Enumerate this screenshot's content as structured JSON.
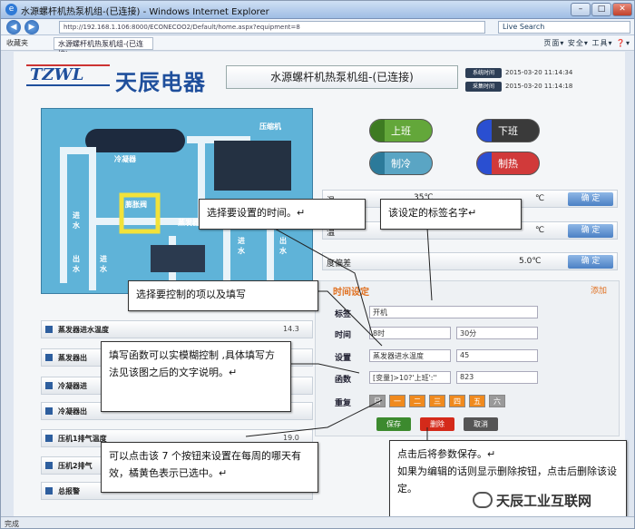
{
  "window": {
    "title": "水源螺杆机热泵机组-(已连接) - Windows Internet Explorer",
    "url": "http://192.168.1.106:8000/ECONECOO2/Default/home.aspx?equipment=8",
    "search": "Live Search",
    "favorites": "收藏夹",
    "tab": "水源螺杆机热泵机组-(已连接)",
    "tools": "页面▾ 安全▾ 工具▾ ❓▾",
    "status": "完成"
  },
  "header": {
    "logo": "TZWL",
    "brand": "天辰电器",
    "machine": "水源螺杆机热泵机组-(已连接)",
    "sys_time_label": "系统时间",
    "sys_time": "2015-03-20 11:14:34",
    "collect_time_label": "采集时间",
    "collect_time": "2015-03-20 11:14:18"
  },
  "diagram": {
    "compressor": "压缩机",
    "condenser": "冷凝器",
    "expansion": "膨胀阀",
    "evaporator": "蒸发器",
    "inlet1": "进水",
    "outlet1": "出水",
    "inlet2": "进水",
    "outlet2": "出水",
    "inlet3": "进水",
    "outlet3": "出水"
  },
  "buttons": {
    "on": "上班",
    "off": "下班",
    "cool": "制冷",
    "heat": "制热"
  },
  "settings": [
    {
      "label": "温",
      "value": "35℃",
      "val2": "℃",
      "ok": "确 定"
    },
    {
      "label": "温",
      "value": "",
      "val2": "℃",
      "ok": "确 定"
    },
    {
      "label": "度偏差",
      "value": "",
      "val2": "5.0℃",
      "ok": "确 定"
    }
  ],
  "panel": {
    "title": "时间设定",
    "add": "添加",
    "name_label": "标签",
    "name_value": "开机",
    "time_label": "时间",
    "hour": "8时",
    "minute": "30分",
    "set_label": "设置",
    "set_item": "蒸发器进水温度",
    "set_value": "45",
    "func_label": "函数",
    "func_value": "[变量]>10?'上班':''",
    "func_value2": "823",
    "repeat_label": "重复",
    "days": [
      "日",
      "一",
      "二",
      "三",
      "四",
      "五",
      "六"
    ],
    "save": "保存",
    "delete": "删除",
    "cancel": "取消"
  },
  "left_rows": [
    {
      "label": "蒸发器进水温度",
      "value": "14.3"
    },
    {
      "label": "蒸发器出",
      "value": ""
    },
    {
      "label": "冷凝器进",
      "value": ""
    },
    {
      "label": "冷凝器出",
      "value": ""
    },
    {
      "label": "压机1排气温度",
      "value": "19.0"
    },
    {
      "label": "压机2排气",
      "value": ""
    },
    {
      "label": "总报警",
      "value": ""
    }
  ],
  "callouts": {
    "c1": "选择要设置的时间。↵",
    "c2": "该设定的标签名字↵",
    "c3": "选择要控制的项以及填写",
    "c4": "填写函数可以实模糊控制 ,具体填写方法见该图之后的文字说明。↵",
    "c5": "可以点击该 7 个按钮来设置在每周的哪天有效，橘黄色表示已选中。↵",
    "c6a": "点击后将参数保存。↵",
    "c6b": "如果为编辑的话则显示删除按钮，点击后删除该设定。"
  },
  "watermark": "天辰工业互联网",
  "colors": {
    "selected_day": "#f08a1e",
    "unselected_day": "#9a9a9a",
    "save": "#3c8a2e",
    "delete": "#d42a1a",
    "cancel": "#555555"
  }
}
